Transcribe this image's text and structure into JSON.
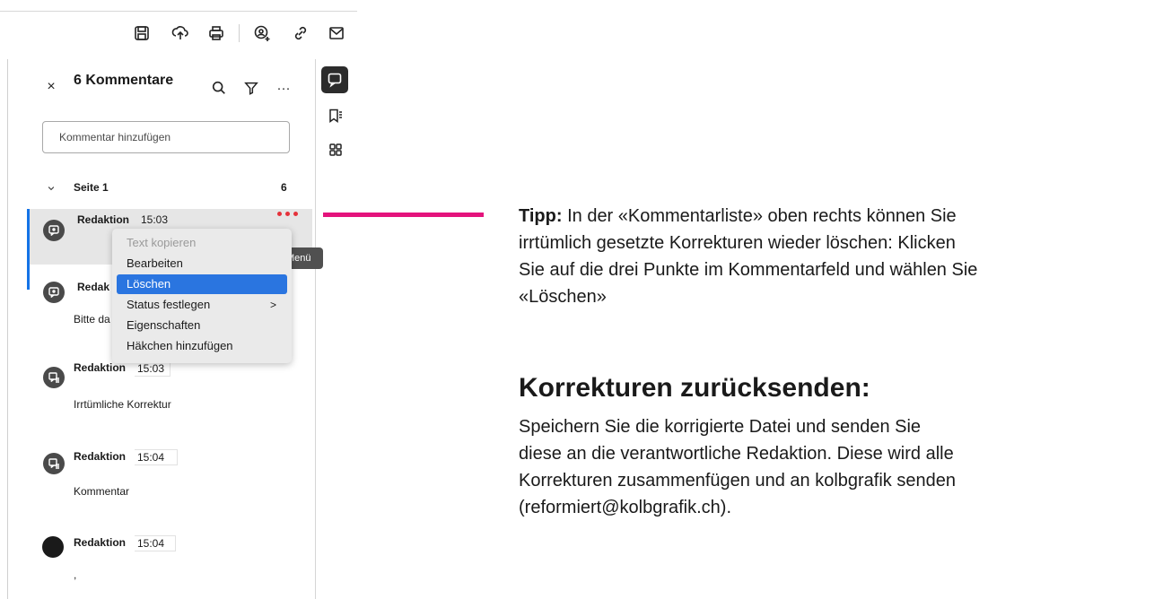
{
  "toolbar": {
    "icons": [
      "save-icon",
      "upload-icon",
      "print-icon",
      "share-user-icon",
      "link-icon",
      "mail-icon"
    ]
  },
  "panel": {
    "title": "6 Kommentare",
    "close_symbol": "×",
    "search_placeholder": "Kommentar hinzufügen",
    "page_label": "Seite 1",
    "page_count": "6",
    "more_symbol": "···"
  },
  "comments": [
    {
      "author": "Redaktion",
      "time": "15:03",
      "text": ""
    },
    {
      "author": "Redak",
      "time": "",
      "text": "Bitte da"
    },
    {
      "author": "Redaktion",
      "time": "15:03",
      "text": "Irrtümliche Korrektur"
    },
    {
      "author": "Redaktion",
      "time": "15:04",
      "text": "Kommentar"
    },
    {
      "author": "Redaktion",
      "time": "15:04",
      "text": ","
    }
  ],
  "context_menu": {
    "items": [
      {
        "label": "Text kopieren",
        "state": "disabled"
      },
      {
        "label": "Bearbeiten",
        "state": "normal"
      },
      {
        "label": "Löschen",
        "state": "highlighted"
      },
      {
        "label": "Status festlegen",
        "state": "submenu",
        "arrow": ">"
      },
      {
        "label": "Eigenschaften",
        "state": "normal"
      },
      {
        "label": "Häkchen hinzufügen",
        "state": "normal"
      }
    ]
  },
  "tooltip": "Menü",
  "rail": {
    "icons": [
      "comment-icon",
      "bookmark-icon",
      "thumbnails-icon"
    ]
  },
  "colors": {
    "accent_blue": "#1473e6",
    "highlight_pink": "#e4137c",
    "dots_red": "#e5323b",
    "menu_active": "#2a75e0"
  },
  "tip": {
    "label": "Tipp:",
    "line1": "In der «Kommentarliste» oben rechts können Sie",
    "line2": "irrtümlich gesetzte Korrekturen wieder löschen: Klicken",
    "line3": "Sie auf die drei Punkte im Kommentarfeld und wählen Sie",
    "line4": "«Löschen»"
  },
  "section": {
    "heading": "Korrekturen zurücksenden:",
    "line1": "Speichern Sie die korrigierte Datei und senden Sie",
    "line2": "diese an die verantwortliche Redaktion. Diese wird alle",
    "line3": "Korrekturen zusammenfügen und an kolbgrafik senden",
    "line4": "(reformiert@kolbgrafik.ch)."
  }
}
